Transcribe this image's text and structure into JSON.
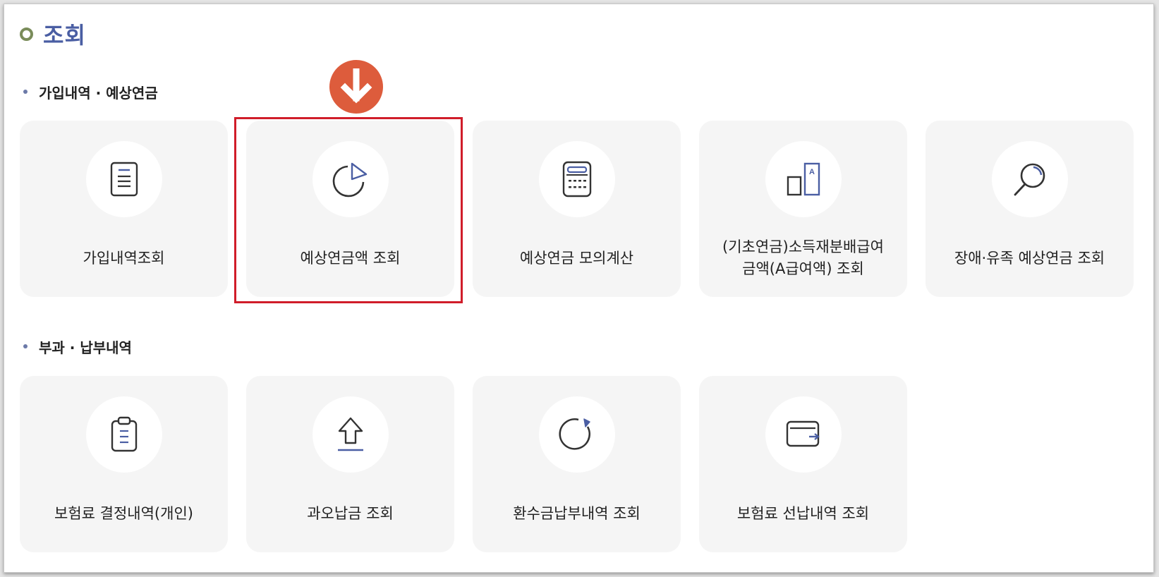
{
  "page": {
    "title": "조회"
  },
  "sections": [
    {
      "title": "가입내역 · 예상연금",
      "cards": [
        {
          "label": "가입내역조회",
          "icon": "document-icon"
        },
        {
          "label": "예상연금액 조회",
          "icon": "pie-chart-icon"
        },
        {
          "label": "예상연금 모의계산",
          "icon": "calculator-icon"
        },
        {
          "label": "(기초연금)소득재분배급여\n금액(A급여액) 조회",
          "icon": "a-value-icon"
        },
        {
          "label": "장애·유족 예상연금 조회",
          "icon": "magnifier-icon"
        }
      ]
    },
    {
      "title": "부과 · 납부내역",
      "cards": [
        {
          "label": "보험료 결정내역(개인)",
          "icon": "clipboard-icon"
        },
        {
          "label": "과오납금 조회",
          "icon": "upload-arrow-icon"
        },
        {
          "label": "환수금납부내역 조회",
          "icon": "refresh-icon"
        },
        {
          "label": "보험료 선납내역 조회",
          "icon": "wallet-icon"
        }
      ]
    }
  ],
  "annotation": {
    "highlighted_card": "예상연금액 조회",
    "icon": "down-arrow-icon"
  },
  "colors": {
    "accent": "#4a5ea3",
    "highlight_border": "#d01d2a",
    "arrow_badge": "#dd5c3c",
    "card_bg": "#f5f5f5"
  }
}
